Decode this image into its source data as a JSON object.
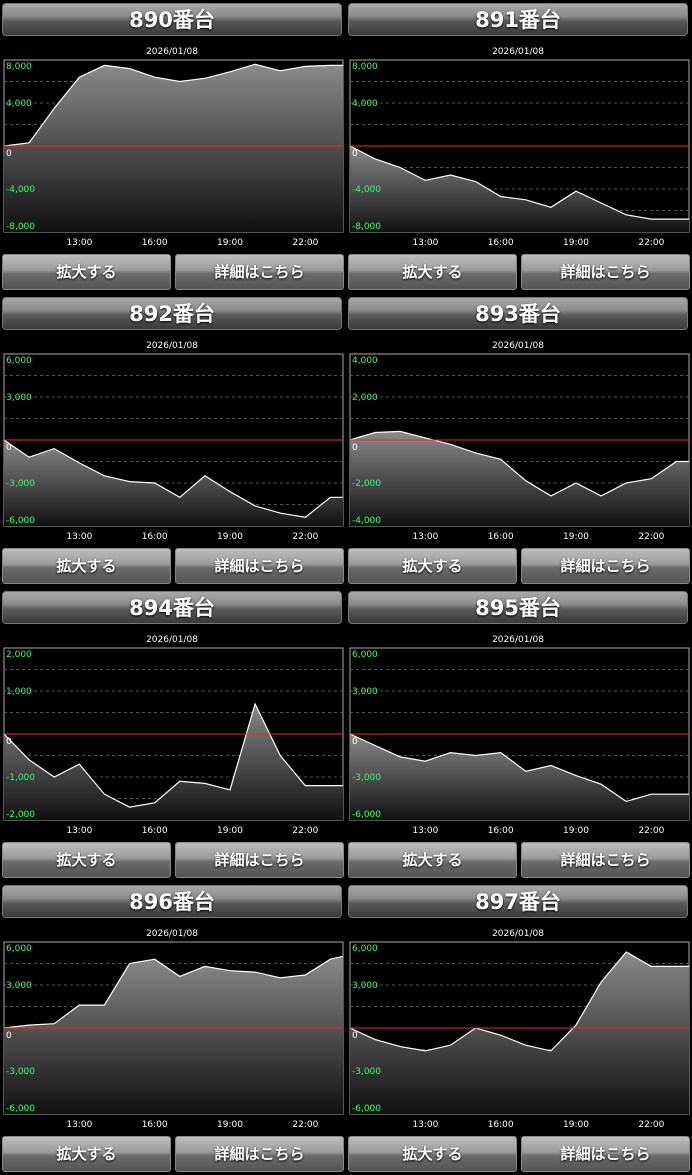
{
  "buttons": {
    "zoom": "拡大する",
    "detail": "詳細はこちら"
  },
  "colors": {
    "zero_line": "#ff2222",
    "tick_y": "#33ff66",
    "grid": "#555555",
    "fill_top": "#8a8a8a",
    "fill_bottom": "#111111",
    "line": "#ffffff"
  },
  "charts": [
    {
      "title": "890番台",
      "date": "2026/01/08",
      "type": "area",
      "x_ticks": [
        "13:00",
        "16:00",
        "19:00",
        "22:00"
      ],
      "y_ticks": [
        8000,
        4000,
        0,
        -4000,
        -8000
      ],
      "y_tick_labels": [
        "8,000",
        "4,000",
        "0",
        "-4,000",
        "-8,000"
      ],
      "ylim": [
        -8000,
        8000
      ],
      "xlim": [
        10,
        23.5
      ],
      "x": [
        10,
        11,
        12,
        13,
        14,
        15,
        16,
        17,
        18,
        19,
        20,
        21,
        22,
        23,
        23.5
      ],
      "values": [
        0,
        300,
        3500,
        6400,
        7500,
        7200,
        6400,
        6000,
        6300,
        6900,
        7600,
        7000,
        7400,
        7500,
        7500
      ]
    },
    {
      "title": "891番台",
      "date": "2026/01/08",
      "type": "area",
      "x_ticks": [
        "13:00",
        "16:00",
        "19:00",
        "22:00"
      ],
      "y_ticks": [
        8000,
        4000,
        0,
        -4000,
        -8000
      ],
      "y_tick_labels": [
        "8,000",
        "4,000",
        "0",
        "-4,000",
        "-8,000"
      ],
      "ylim": [
        -8000,
        8000
      ],
      "xlim": [
        10,
        23.5
      ],
      "x": [
        10,
        11,
        12,
        13,
        14,
        15,
        16,
        17,
        18,
        19,
        20,
        21,
        22,
        23,
        23.5
      ],
      "values": [
        0,
        -1200,
        -2000,
        -3200,
        -2700,
        -3300,
        -4700,
        -5000,
        -5700,
        -4200,
        -5300,
        -6400,
        -6800,
        -6800,
        -6800
      ]
    },
    {
      "title": "892番台",
      "date": "2026/01/08",
      "type": "area",
      "x_ticks": [
        "13:00",
        "16:00",
        "19:00",
        "22:00"
      ],
      "y_ticks": [
        6000,
        3000,
        0,
        -3000,
        -6000
      ],
      "y_tick_labels": [
        "6,000",
        "3,000",
        "0",
        "-3,000",
        "-6,000"
      ],
      "ylim": [
        -6000,
        6000
      ],
      "xlim": [
        10,
        23.5
      ],
      "x": [
        10,
        11,
        12,
        13,
        14,
        15,
        16,
        17,
        18,
        19,
        20,
        21,
        22,
        23,
        23.5
      ],
      "values": [
        0,
        -1200,
        -600,
        -1600,
        -2500,
        -2900,
        -3000,
        -4000,
        -2500,
        -3600,
        -4600,
        -5100,
        -5400,
        -4000,
        -4000
      ]
    },
    {
      "title": "893番台",
      "date": "2026/01/08",
      "type": "area",
      "x_ticks": [
        "13:00",
        "16:00",
        "19:00",
        "22:00"
      ],
      "y_ticks": [
        4000,
        2000,
        0,
        -2000,
        -4000
      ],
      "y_tick_labels": [
        "4,000",
        "2,000",
        "0",
        "-2,000",
        "-4,000"
      ],
      "ylim": [
        -4000,
        4000
      ],
      "xlim": [
        10,
        23.5
      ],
      "x": [
        10,
        11,
        12,
        13,
        14,
        15,
        16,
        17,
        18,
        19,
        20,
        21,
        22,
        23,
        23.5
      ],
      "values": [
        0,
        350,
        400,
        100,
        -200,
        -600,
        -900,
        -1900,
        -2600,
        -2000,
        -2600,
        -2000,
        -1800,
        -1000,
        -1000
      ]
    },
    {
      "title": "894番台",
      "date": "2026/01/08",
      "type": "area",
      "x_ticks": [
        "13:00",
        "16:00",
        "19:00",
        "22:00"
      ],
      "y_ticks": [
        2000,
        1000,
        0,
        -1000,
        -2000
      ],
      "y_tick_labels": [
        "2,000",
        "1,000",
        "0",
        "-1,000",
        "-2,000"
      ],
      "ylim": [
        -2000,
        2000
      ],
      "xlim": [
        10,
        23.5
      ],
      "x": [
        10,
        11,
        12,
        13,
        14,
        15,
        16,
        17,
        18,
        19,
        20,
        21,
        22,
        23,
        23.5
      ],
      "values": [
        0,
        -600,
        -1000,
        -700,
        -1400,
        -1700,
        -1600,
        -1100,
        -1150,
        -1300,
        700,
        -500,
        -1200,
        -1200,
        -1200
      ]
    },
    {
      "title": "895番台",
      "date": "2026/01/08",
      "type": "area",
      "x_ticks": [
        "13:00",
        "16:00",
        "19:00",
        "22:00"
      ],
      "y_ticks": [
        6000,
        3000,
        0,
        -3000,
        -6000
      ],
      "y_tick_labels": [
        "6,000",
        "3,000",
        "0",
        "-3,000",
        "-6,000"
      ],
      "ylim": [
        -6000,
        6000
      ],
      "xlim": [
        10,
        23.5
      ],
      "x": [
        10,
        11,
        12,
        13,
        14,
        15,
        16,
        17,
        18,
        19,
        20,
        21,
        22,
        23,
        23.5
      ],
      "values": [
        0,
        -800,
        -1600,
        -1900,
        -1300,
        -1500,
        -1300,
        -2600,
        -2200,
        -2900,
        -3500,
        -4700,
        -4200,
        -4200,
        -4200
      ]
    },
    {
      "title": "896番台",
      "date": "2026/01/08",
      "type": "area",
      "x_ticks": [
        "13:00",
        "16:00",
        "19:00",
        "22:00"
      ],
      "y_ticks": [
        6000,
        3000,
        0,
        -3000,
        -6000
      ],
      "y_tick_labels": [
        "6,000",
        "3,000",
        "0",
        "-3,000",
        "-6,000"
      ],
      "ylim": [
        -6000,
        6000
      ],
      "xlim": [
        10,
        23.5
      ],
      "x": [
        10,
        11,
        12,
        13,
        14,
        15,
        16,
        17,
        18,
        19,
        20,
        21,
        22,
        23,
        23.5
      ],
      "values": [
        0,
        200,
        300,
        1600,
        1600,
        4500,
        4800,
        3600,
        4300,
        4000,
        3900,
        3500,
        3700,
        4800,
        5000
      ]
    },
    {
      "title": "897番台",
      "date": "2026/01/08",
      "type": "area",
      "x_ticks": [
        "13:00",
        "16:00",
        "19:00",
        "22:00"
      ],
      "y_ticks": [
        6000,
        3000,
        0,
        -3000,
        -6000
      ],
      "y_tick_labels": [
        "6,000",
        "3,000",
        "0",
        "-3,000",
        "-6,000"
      ],
      "ylim": [
        -6000,
        6000
      ],
      "xlim": [
        10,
        23.5
      ],
      "x": [
        10,
        11,
        12,
        13,
        14,
        15,
        16,
        17,
        18,
        19,
        20,
        21,
        22,
        23,
        23.5
      ],
      "values": [
        0,
        -800,
        -1300,
        -1600,
        -1200,
        0,
        -500,
        -1200,
        -1600,
        200,
        3200,
        5300,
        4300,
        4300,
        4300
      ]
    }
  ]
}
